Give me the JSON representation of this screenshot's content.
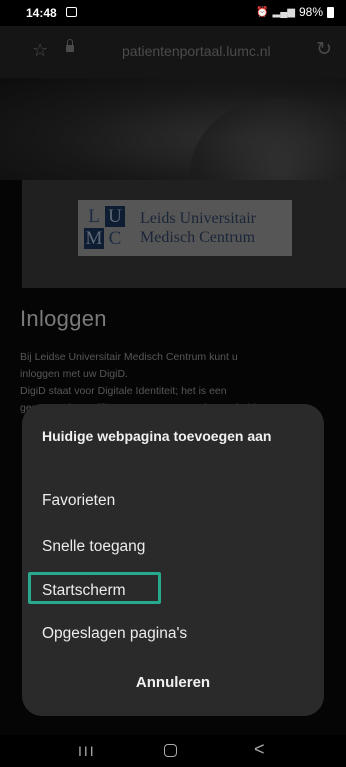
{
  "status_bar": {
    "time": "14:48",
    "battery": "98%",
    "icons": [
      "image-icon",
      "alarm-icon",
      "signal-icon",
      "battery-icon"
    ]
  },
  "browser": {
    "url": "patientenportaal.lumc.nl",
    "icons": [
      "star-icon",
      "lock-icon",
      "reload-icon"
    ]
  },
  "page": {
    "logo": {
      "letters": [
        "L",
        "U",
        "M",
        "C"
      ],
      "line1": "Leids Universitair",
      "line2": "Medisch Centrum"
    },
    "login_title": "Inloggen",
    "body_lines": [
      "Bij Leidse Universitair Medisch Centrum kunt u",
      "inloggen met uw DigiD.",
      "DigiD staat voor Digitale Identiteit; het is een",
      "gemeenschappelijk systeem waarmee de overheid op"
    ]
  },
  "sheet": {
    "title": "Huidige webpagina toevoegen aan",
    "items": [
      {
        "label": "Favorieten"
      },
      {
        "label": "Snelle toegang"
      },
      {
        "label": "Startscherm",
        "highlighted": true
      },
      {
        "label": "Opgeslagen pagina's"
      }
    ],
    "cancel_label": "Annuleren",
    "highlight_color": "#27a98e"
  },
  "nav_bar": {
    "recent_glyph": "III",
    "back_glyph": "<"
  }
}
